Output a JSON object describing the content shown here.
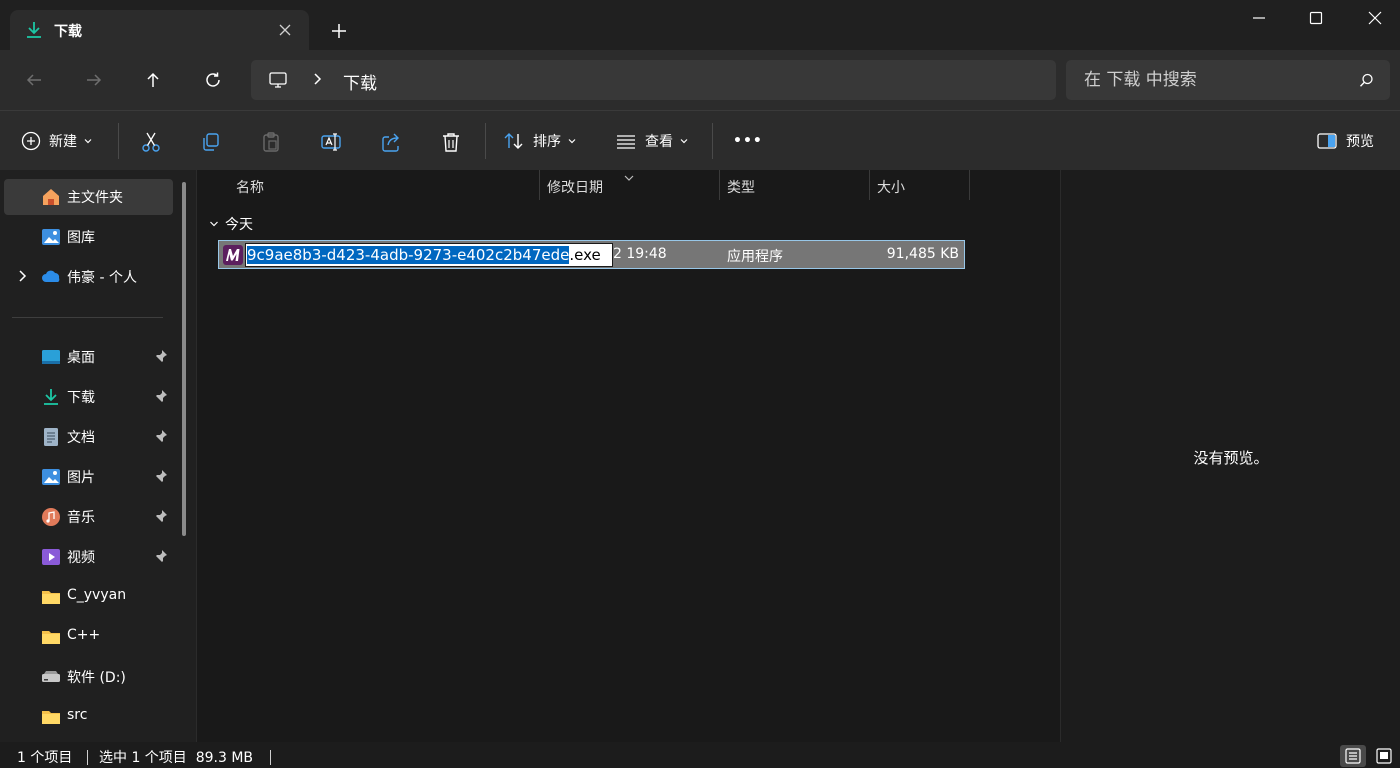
{
  "window": {
    "tab_title": "下载",
    "accent": "#1cc7a5"
  },
  "address": {
    "crumb": "下载"
  },
  "search": {
    "placeholder": "在 下载 中搜索"
  },
  "command_bar": {
    "new_label": "新建",
    "sort_label": "排序",
    "view_label": "查看",
    "more_label": "•••",
    "preview_label": "预览"
  },
  "sidebar": {
    "top_items": [
      {
        "label": "主文件夹",
        "icon": "home-icon"
      },
      {
        "label": "图库",
        "icon": "gallery-icon"
      },
      {
        "label": "伟豪 - 个人",
        "icon": "onedrive-icon"
      }
    ],
    "pinned_items": [
      {
        "label": "桌面",
        "icon": "desktop-icon"
      },
      {
        "label": "下载",
        "icon": "download-icon"
      },
      {
        "label": "文档",
        "icon": "document-icon"
      },
      {
        "label": "图片",
        "icon": "pictures-icon"
      },
      {
        "label": "音乐",
        "icon": "music-icon"
      },
      {
        "label": "视频",
        "icon": "video-icon"
      }
    ],
    "other_items": [
      {
        "label": "C_yvyan",
        "icon": "folder-icon"
      },
      {
        "label": "C++",
        "icon": "folder-icon"
      },
      {
        "label": "软件 (D:)",
        "icon": "drive-icon"
      },
      {
        "label": "src",
        "icon": "folder-icon"
      }
    ]
  },
  "columns": {
    "name": "名称",
    "modified": "修改日期",
    "type": "类型",
    "size": "大小"
  },
  "group": {
    "label": "今天"
  },
  "files": [
    {
      "name_selected": "9c9ae8b3-d423-4adb-9273-e402c2b47ede",
      "name_ext": ".exe",
      "modified": "2 19:48",
      "type": "应用程序",
      "size": "91,485 KB"
    }
  ],
  "preview": {
    "message": "没有预览。"
  },
  "status": {
    "item_count": "1 个项目",
    "selection": "选中 1 个项目  89.3 MB"
  }
}
